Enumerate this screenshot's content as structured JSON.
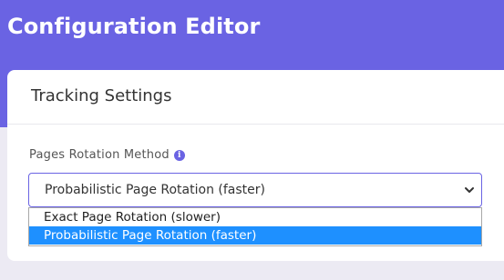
{
  "header": {
    "title": "Configuration Editor"
  },
  "card": {
    "title": "Tracking Settings",
    "field_label": "Pages Rotation Method",
    "info_icon": "info-icon",
    "select": {
      "value": "Probabilistic Page Rotation (faster)",
      "options": [
        "Exact Page Rotation (slower)",
        "Probabilistic Page Rotation (faster)"
      ]
    }
  },
  "colors": {
    "accent": "#6a63e3",
    "selected_option": "#1e90ff"
  }
}
